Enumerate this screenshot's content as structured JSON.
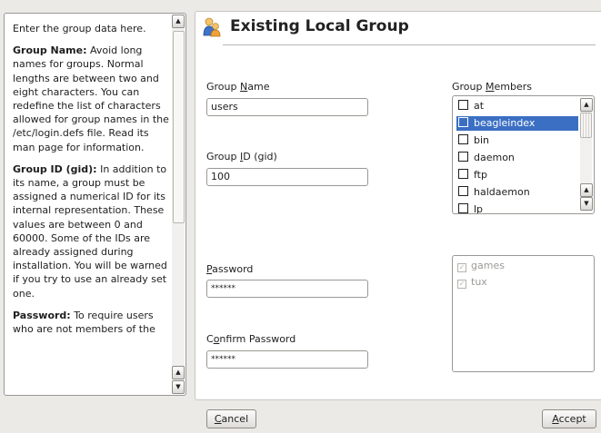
{
  "help": {
    "intro": "Enter the group data here.",
    "name_heading": "Group Name:",
    "name_text": " Avoid long names for groups. Normal lengths are between two and eight characters. You can redefine the list of characters allowed for group names in the /etc/login.defs file. Read its man page for information.",
    "gid_heading": "Group ID (gid):",
    "gid_text": " In addition to its name, a group must be assigned a numerical ID for its internal representation. These values are between 0 and 60000. Some of the IDs are already assigned during installation. You will be warned if you try to use an already set one.",
    "password_heading": "Password:",
    "password_text": " To require users who are not members of the"
  },
  "dialog": {
    "title": "Existing Local Group",
    "icon": "group-users-icon"
  },
  "form": {
    "group_name": {
      "label_pre": "Group ",
      "label_key": "N",
      "label_post": "ame",
      "value": "users"
    },
    "group_id": {
      "label_pre": "Group ",
      "label_key": "I",
      "label_post": "D (gid)",
      "value": "100"
    },
    "password": {
      "label_pre": "",
      "label_key": "P",
      "label_post": "assword",
      "value": "******"
    },
    "confirm_password": {
      "label_pre": "C",
      "label_key": "o",
      "label_post": "nfirm Password",
      "value": "******"
    }
  },
  "members": {
    "label_pre": "Group ",
    "label_key": "M",
    "label_post": "embers",
    "items": [
      "at",
      "beagleindex",
      "bin",
      "daemon",
      "ftp",
      "haldaemon",
      "lp"
    ],
    "selected": "beagleindex"
  },
  "extra_members": {
    "items": [
      "games",
      "tux"
    ]
  },
  "buttons": {
    "cancel_key": "C",
    "cancel_rest": "ancel",
    "accept_key": "A",
    "accept_rest": "ccept"
  },
  "colors": {
    "selection": "#3b6fc4",
    "window_bg": "#eceae6"
  }
}
